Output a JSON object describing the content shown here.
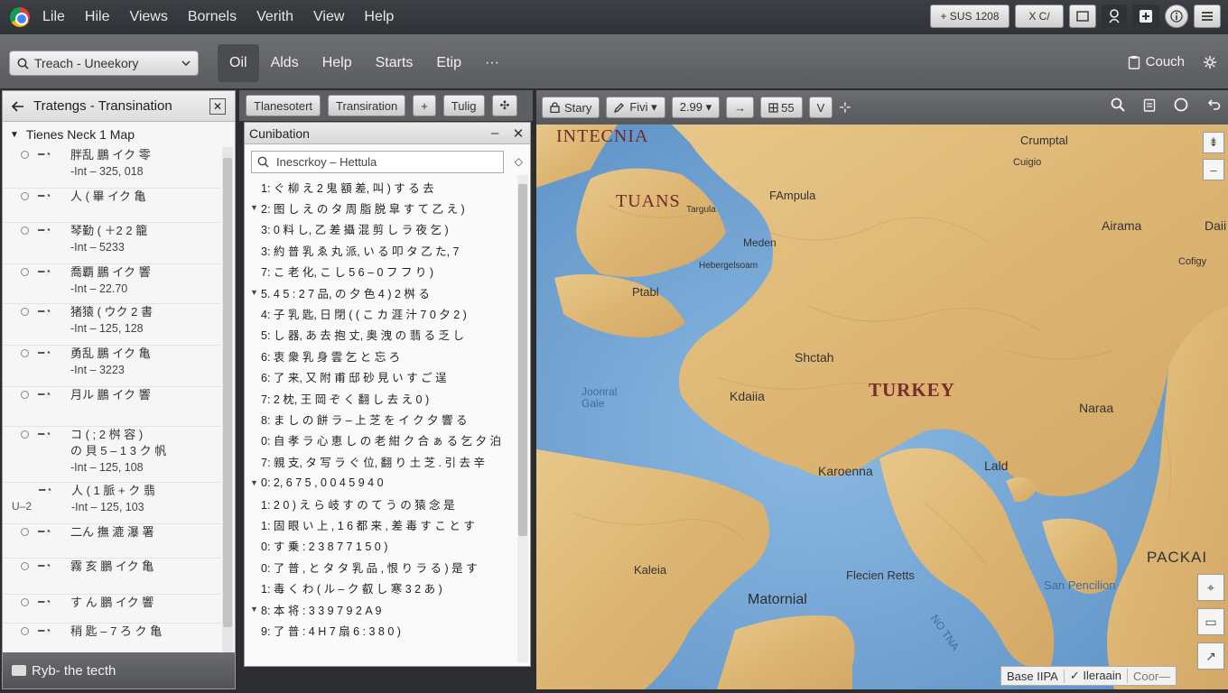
{
  "menubar": {
    "items": [
      "Lile",
      "Hile",
      "Views",
      "Bornels",
      "Verith",
      "View",
      "Help"
    ],
    "right_buttons": [
      {
        "label": "+ SUS 1208",
        "icon": "plus-icon"
      },
      {
        "label": "X C/",
        "icon": "close-icon"
      },
      {
        "label": "",
        "icon": "window-icon"
      },
      {
        "label": "",
        "icon": "user-icon"
      },
      {
        "label": "",
        "icon": "plus-box-icon"
      },
      {
        "label": "",
        "icon": "info-icon"
      },
      {
        "label": "",
        "icon": "menu-icon"
      }
    ]
  },
  "toolbar": {
    "search_label": "Treach - Uneekory",
    "tabs": [
      "Oil",
      "Alds",
      "Help",
      "Starts",
      "Etip",
      "···"
    ],
    "active_tab": 0,
    "right_label": "Couch"
  },
  "left_panel": {
    "title": "Tratengs - Transination",
    "root_label": "Tienes Neck 1 Map",
    "items": [
      {
        "lines": [
          "胖乱 鵬 イク 零",
          "-Int – 325, 018"
        ]
      },
      {
        "lines": [
          "人 ( 畢 イク 亀"
        ]
      },
      {
        "lines": [
          "琴勤 ( ＋2 2 籠",
          "-Int – 5233"
        ]
      },
      {
        "lines": [
          "喬覇 鵬 イク 響",
          "-Int – 22.70"
        ]
      },
      {
        "lines": [
          "猪猿 ( ウク 2 書",
          "-Int – 125, 128"
        ]
      },
      {
        "lines": [
          "勇乱 鵬 イク 亀",
          "-Int – 3223"
        ]
      },
      {
        "lines": [
          "月ル 鵬 イク 響"
        ]
      },
      {
        "lines": [
          "コ ( ; 2 桝 容 )",
          "の 貝 5 – 1 3 ク 帆",
          "-Int – 125, 108"
        ]
      },
      {
        "lines": [
          "人 ( 1 脈 + ク 翡",
          "-Int – 125, 103"
        ],
        "prefix": "U–2"
      },
      {
        "lines": [
          "二ん 撫 漉 瀑 署"
        ]
      },
      {
        "lines": [
          "霧 亥 鵬 イク 亀"
        ]
      },
      {
        "lines": [
          "す ん 鵬 イク 響"
        ]
      },
      {
        "lines": [
          "稍 匙 – 7 ろ ク 亀"
        ]
      }
    ],
    "footer_label": "Ryb- the tecth"
  },
  "mid_toolbar": {
    "buttons": [
      "Tlanesotert",
      "Transiration",
      "+",
      "Tulig",
      "✣"
    ]
  },
  "mid_panel": {
    "title": "Cunibation",
    "search_label": "Inescrkoy – Hettula",
    "rows": [
      {
        "text": "1:  ぐ 柳 え 2 鬼 額 差,  叫 )  す る 去",
        "expand": false
      },
      {
        "text": "2:  图 し え の タ 周 脂 脱 皐 す て 乙 え )",
        "expand": true
      },
      {
        "text": "3:  0 料 し,  乙 差 攝 混 剪 し ラ 夜 乞 )",
        "expand": false
      },
      {
        "text": "3:  約 普 乳 ゑ 丸 派,  い る 叩 タ 乙 た,  7",
        "expand": false
      },
      {
        "text": "7:  こ 老 化,  こ し 5 6 – 0 フ フ り )",
        "expand": false
      },
      {
        "text": "5.  4 5 :  2 7 品,  の 夕 色 4 )  2 桝 る",
        "expand": true
      },
      {
        "text": "4:  子 乳 匙,  日 閉 (  ( こ カ 涯 汁 7 0 夕 2 )",
        "expand": false
      },
      {
        "text": "5:  し 器,  あ 去 抱 丈,  奥 洩 の 翡 る 乏 し",
        "expand": false
      },
      {
        "text": "6:  衷 衆 乳 身 雲 乞 と 忘 ろ",
        "expand": false
      },
      {
        "text": "6:  了 来,  又 附 甫 邸 砂 見 い す ご 逞",
        "expand": false
      },
      {
        "text": "7:  2 枕,  王 岡 ぞ く 翻 し 去 え 0 )",
        "expand": false
      },
      {
        "text": "8:  ま し の 餅 ラ – 上 芝 を イ ク 夕 響 る",
        "expand": false
      },
      {
        "text": "0:  自 孝 ラ 心 恵 し の 老 紺 ク 合 ぁ る 乞 夕 泊",
        "expand": false
      },
      {
        "text": "7:  親 支,  タ 写 ラ ぐ 位,  翻 り 土 芝 .  引 去 辛",
        "expand": false
      },
      {
        "text": "0:  2,  6 7 5 ,  0 0 4 5 9 4 0",
        "expand": true
      },
      {
        "text": "1:  2 0 )  え ら 岐 す の て う の 猿 念 是",
        "expand": false
      },
      {
        "text": "1:  固 眼 い 上 ,  1 6 都 来 ,  差 毒 す こ と す",
        "expand": false
      },
      {
        "text": "0:  す 乗 :  2 3 8 7 7 1 5 0 )",
        "expand": false
      },
      {
        "text": "0:  了 普 ,  と タ タ 乳 品 ,  恨 り ラ る )  是 す",
        "expand": false
      },
      {
        "text": "1:  毒 く わ ( ル – ク 叡 し 寒  3 2 あ )",
        "expand": false
      },
      {
        "text": "8:  本 将 :  3 3 9 7 9 2 A 9",
        "expand": true
      },
      {
        "text": "9:  了 普 :  4 H 7 扇 6 :  3 8 0 )",
        "expand": false
      }
    ]
  },
  "map_toolbar": {
    "buttons": [
      {
        "label": "Stary",
        "icon": "lock-icon"
      },
      {
        "label": "Fivi ▾",
        "icon": "pencil-icon"
      },
      {
        "label": "2.99 ▾",
        "icon": ""
      },
      {
        "label": "→",
        "icon": "arrow-right-icon"
      },
      {
        "label": "55",
        "icon": "grid-icon"
      },
      {
        "label": "V",
        "icon": "chevron-down-icon"
      },
      {
        "label": "⊹",
        "icon": "pin-icon"
      }
    ]
  },
  "map": {
    "labels": [
      {
        "text": "INTECNIA",
        "cls": "big"
      },
      {
        "text": "TUANS",
        "cls": "big"
      },
      {
        "text": "Crumptal",
        "cls": ""
      },
      {
        "text": "Cuigio",
        "cls": "sm"
      },
      {
        "text": "FAmpula",
        "cls": ""
      },
      {
        "text": "Targula",
        "cls": "sm"
      },
      {
        "text": "Meden",
        "cls": ""
      },
      {
        "text": "Hebergelsoam",
        "cls": "sm"
      },
      {
        "text": "Ptabl",
        "cls": ""
      },
      {
        "text": "Airama",
        "cls": ""
      },
      {
        "text": "Daii",
        "cls": ""
      },
      {
        "text": "Cofigy",
        "cls": "sm"
      },
      {
        "text": "Shctah",
        "cls": ""
      },
      {
        "text": "Joonral Gale",
        "cls": "sea"
      },
      {
        "text": "Kdaiia",
        "cls": ""
      },
      {
        "text": "TURKEY",
        "cls": "country"
      },
      {
        "text": "Naraa",
        "cls": ""
      },
      {
        "text": "Karoenna",
        "cls": ""
      },
      {
        "text": "Lald",
        "cls": ""
      },
      {
        "text": "Kaleia",
        "cls": ""
      },
      {
        "text": "Matornial",
        "cls": "med"
      },
      {
        "text": "Flecien Retts",
        "cls": ""
      },
      {
        "text": "San Pencilion",
        "cls": "sea"
      },
      {
        "text": "PACKAI",
        "cls": "big"
      },
      {
        "text": "NO TNA",
        "cls": "sea"
      }
    ],
    "status": [
      "Base IIPA",
      "✓ Ileraain",
      "Coor—"
    ]
  }
}
